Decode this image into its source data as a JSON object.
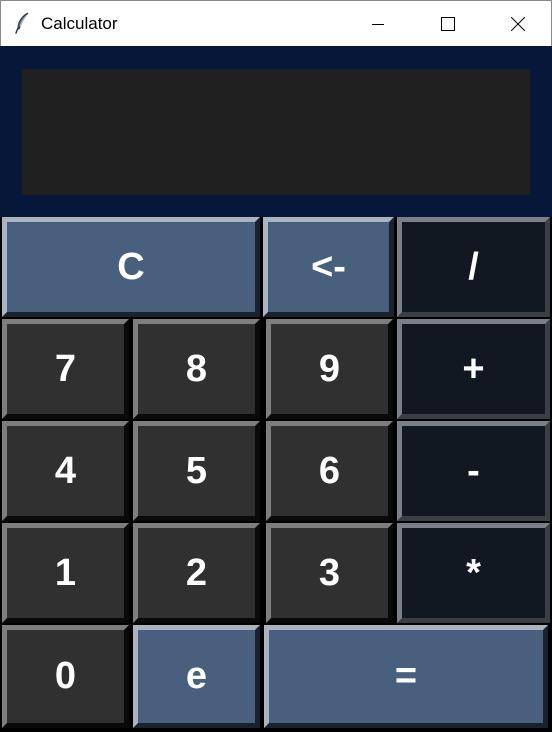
{
  "window": {
    "title": "Calculator",
    "icon": "feather-icon"
  },
  "display": {
    "value": ""
  },
  "keys": {
    "clear": "C",
    "backspace": "<-",
    "divide": "/",
    "seven": "7",
    "eight": "8",
    "nine": "9",
    "plus": "+",
    "four": "4",
    "five": "5",
    "six": "6",
    "minus": "-",
    "one": "1",
    "two": "2",
    "three": "3",
    "multiply": "*",
    "zero": "0",
    "e": "e",
    "equals": "="
  },
  "colors": {
    "display_frame": "#06173a",
    "display_screen": "#202020",
    "number_key": "#303030",
    "function_key": "#48607e",
    "operator_key": "#121821",
    "key_text": "#ffffff"
  }
}
